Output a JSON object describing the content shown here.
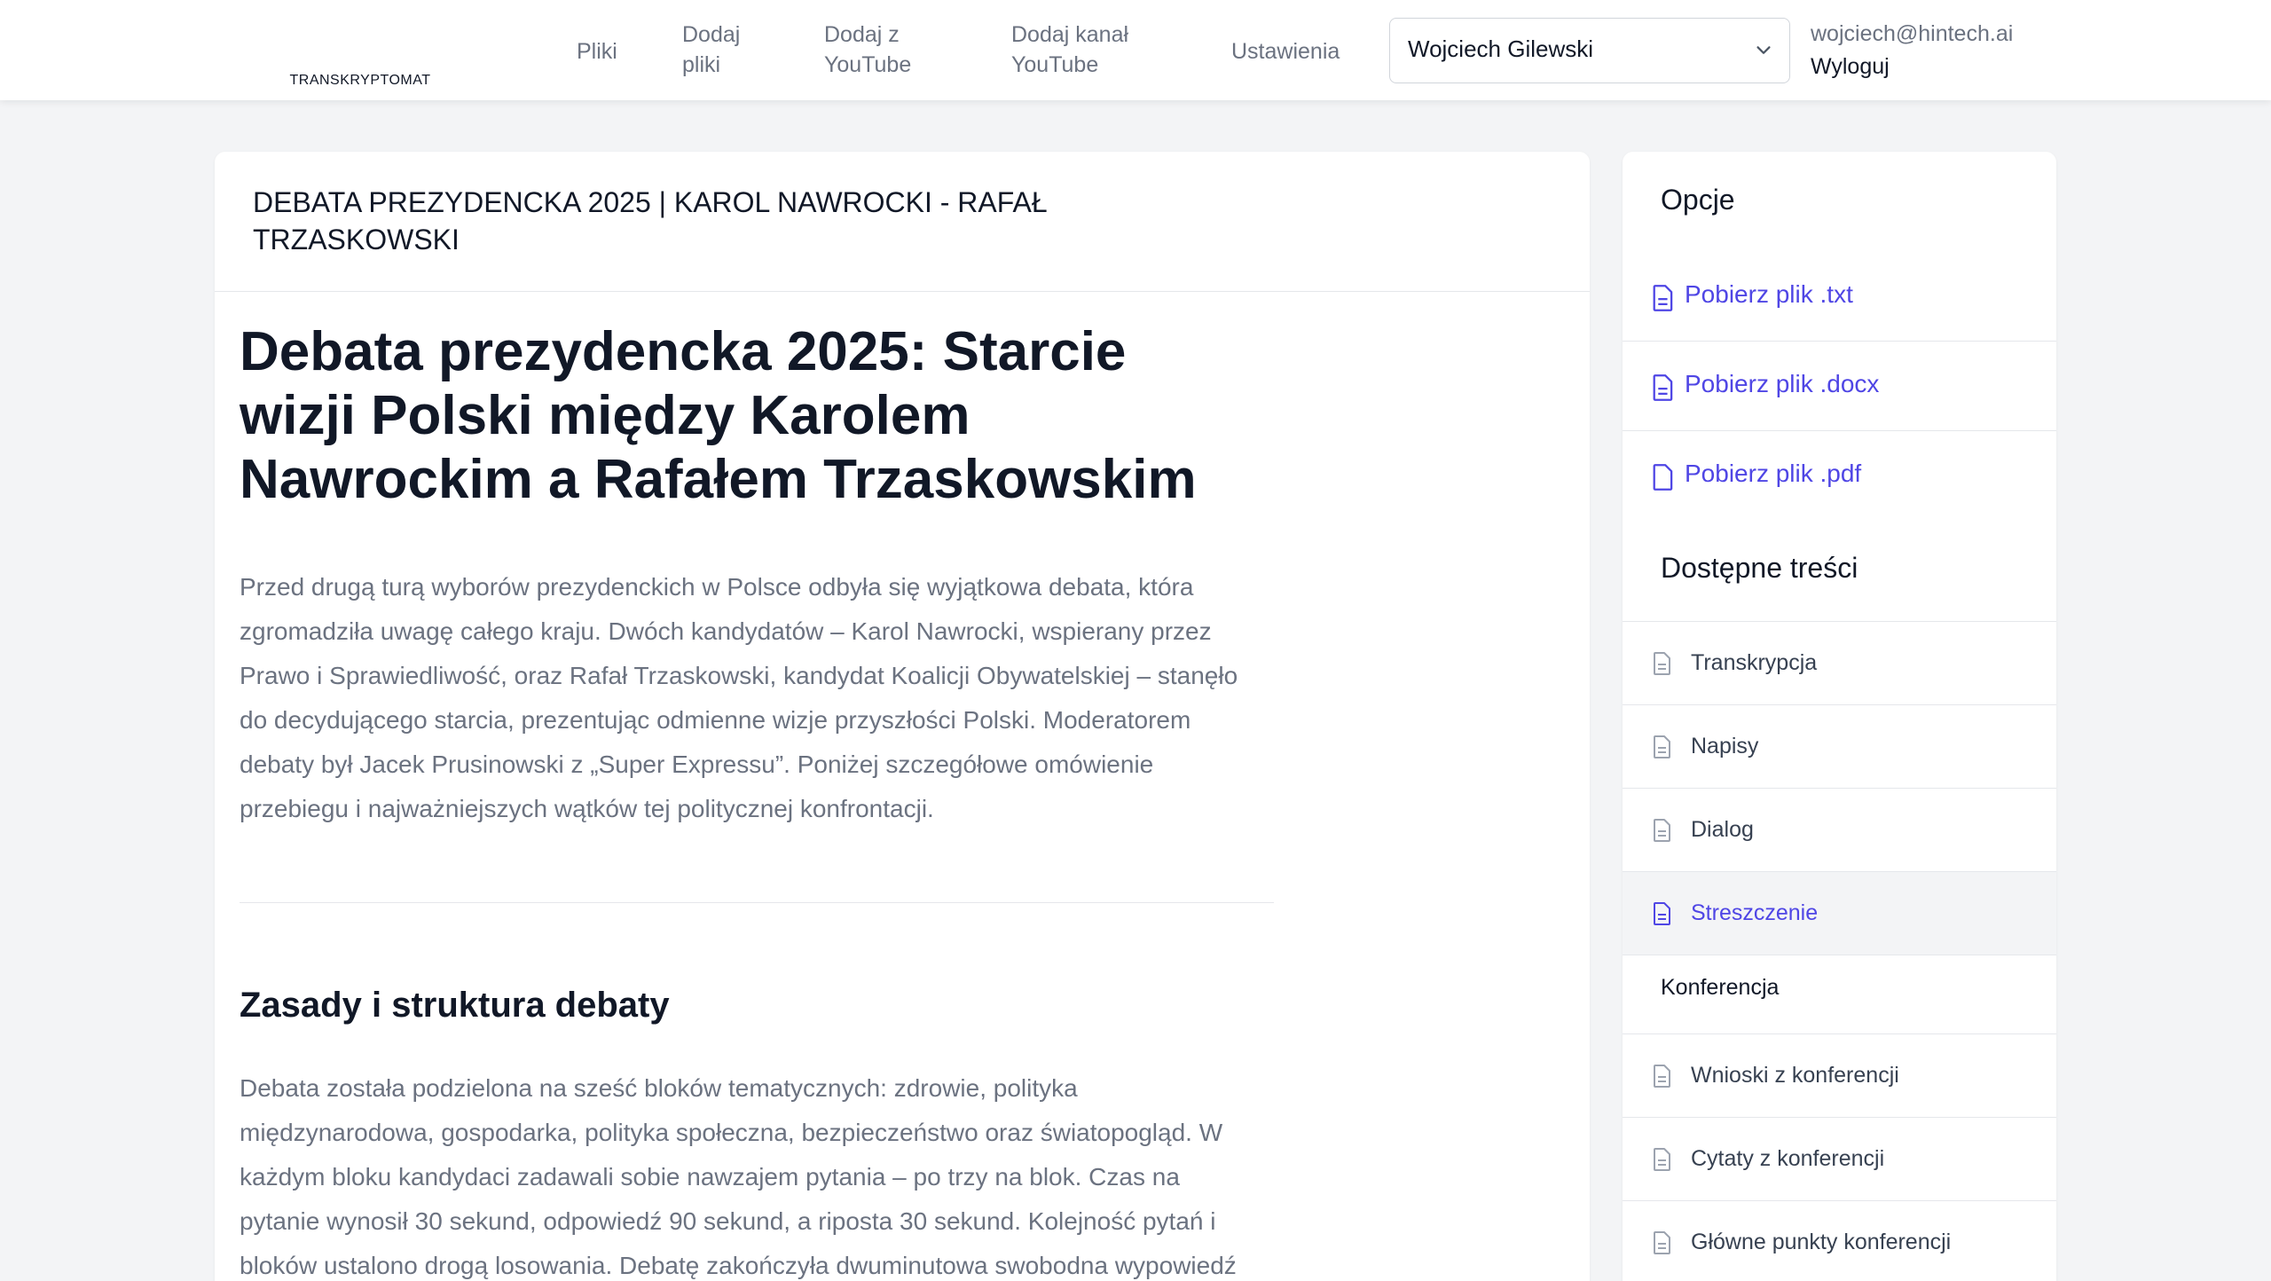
{
  "brand": {
    "name": "TRANSKRYPTOMAT",
    "accent": "#6366f1"
  },
  "nav": [
    {
      "id": "pliki",
      "label": "Pliki"
    },
    {
      "id": "dodaj-pliki",
      "label_line1": "Dodaj",
      "label_line2": "pliki"
    },
    {
      "id": "dodaj-youtube",
      "label_line1": "Dodaj z",
      "label_line2": "YouTube"
    },
    {
      "id": "dodaj-kanal",
      "label_line1": "Dodaj kanał",
      "label_line2": "YouTube"
    },
    {
      "id": "ustawienia",
      "label": "Ustawienia"
    }
  ],
  "user_select": {
    "value": "Wojciech Gilewski"
  },
  "account": {
    "email": "wojciech@hintech.ai",
    "logout": "Wyloguj"
  },
  "file": {
    "title_line1": "DEBATA PREZYDENCKA 2025 | KAROL NAWROCKI - RAFAŁ",
    "title_line2": "TRZASKOWSKI"
  },
  "article": {
    "h1_line1": "Debata prezydencka 2025: Starcie",
    "h1_line2": "wizji Polski między Karolem",
    "h1_line3": "Nawrockim a Rafałem Trzaskowskim",
    "lead": [
      "Przed drugą turą wyborów prezydenckich w Polsce odbyła się wyjątkowa debata, która",
      "zgromadziła uwagę całego kraju. Dwóch kandydatów – Karol Nawrocki, wspierany przez",
      "Prawo i Sprawiedliwość, oraz Rafał Trzaskowski, kandydat Koalicji Obywatelskiej – stanęło",
      "do decydującego starcia, prezentując odmienne wizje przyszłości Polski. Moderatorem",
      "debaty był Jacek Prusinowski z „Super Expressu”. Poniżej szczegółowe omówienie",
      "przebiegu i najważniejszych wątków tej politycznej konfrontacji."
    ],
    "h2": "Zasady i struktura debaty",
    "para": [
      "Debata została podzielona na sześć bloków tematycznych: zdrowie, polityka",
      "międzynarodowa, gospodarka, polityka społeczna, bezpieczeństwo oraz światopogląd. W",
      "każdym bloku kandydaci zadawali sobie nawzajem pytania – po trzy na blok. Czas na",
      "pytanie wynosił 30 sekund, odpowiedź 90 sekund, a riposta 30 sekund. Kolejność pytań i",
      "bloków ustalono drogą losowania. Debatę zakończyła dwuminutowa swobodna wypowiedź"
    ]
  },
  "sidebar": {
    "options_title": "Opcje",
    "downloads": [
      {
        "label": "Pobierz plik .txt",
        "icon": "document-icon"
      },
      {
        "label": "Pobierz plik .docx",
        "icon": "document-icon"
      },
      {
        "label": "Pobierz plik .pdf",
        "icon": "blank-document-icon"
      }
    ],
    "content_title": "Dostępne treści",
    "contents": [
      {
        "label": "Transkrypcja"
      },
      {
        "label": "Napisy"
      },
      {
        "label": "Dialog"
      },
      {
        "label": "Streszczenie",
        "active": true
      }
    ],
    "conference_title": "Konferencja",
    "conference": [
      {
        "label": "Wnioski z konferencji"
      },
      {
        "label": "Cytaty z konferencji"
      },
      {
        "label": "Główne punkty konferencji"
      }
    ]
  }
}
